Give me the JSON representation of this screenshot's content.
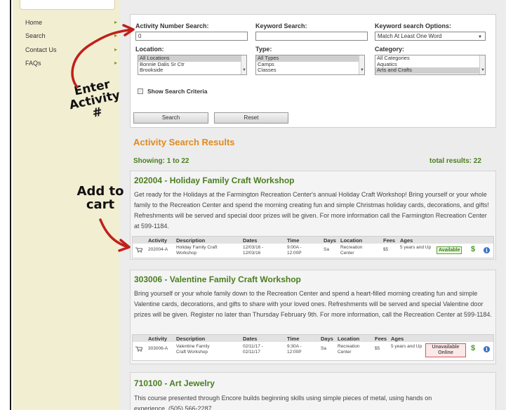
{
  "sidebar": {
    "items": [
      {
        "label": "Home"
      },
      {
        "label": "Search"
      },
      {
        "label": "Contact Us"
      },
      {
        "label": "FAQs"
      }
    ],
    "arrow": "▸"
  },
  "search": {
    "activity_number_label": "Activity Number Search:",
    "activity_number_value": "0",
    "keyword_label": "Keyword Search:",
    "keyword_value": "",
    "keyword_options_label": "Keyword search Options:",
    "keyword_options_value": "Match At Least One Word",
    "location_label": "Location:",
    "location_options": [
      "All Locations",
      "Bonnie Dalis Sr Ctr",
      "Brookside"
    ],
    "type_label": "Type:",
    "type_options": [
      "All Types",
      "Camps",
      "Classes"
    ],
    "category_label": "Category:",
    "category_options": [
      "All Categories",
      "Aquatics",
      "Arts and Crafts"
    ],
    "show_criteria_label": "Show Search Criteria",
    "search_button": "Search",
    "reset_button": "Reset"
  },
  "results": {
    "title": "Activity Search Results",
    "showing": "Showing: 1 to 22",
    "total": "total results: 22"
  },
  "table_headers": [
    "Activity",
    "Description",
    "Dates",
    "Time",
    "Days",
    "Location",
    "Fees",
    "Ages"
  ],
  "cards": [
    {
      "title": "202004 - Holiday Family Craft Workshop",
      "desc": "Get ready for the Holidays at the Farmington Recreation Center's annual Holiday Craft Workshop! Bring yourself or your whole family to the Recreation Center and spend the morning creating fun and simple Christmas holiday cards, decorations, and gifts! Refreshments will be served and special door prizes will be given. For more information call the Farmington Recreation Center at 599-1184.",
      "row": {
        "activity": "202004-A",
        "description": "Holiday Family Craft Workshop",
        "dates": "12/03/16 - 12/03/16",
        "time": "9:00A - 12:00P",
        "days": "Sa",
        "location": "Recreation Center",
        "fees": "$5",
        "ages": "5 years and Up",
        "status": "Available"
      }
    },
    {
      "title": "303006 - Valentine Family Craft Workshop",
      "desc": "Bring yourself or your whole family down to the Recreation Center and spend a heart-filled morning creating fun and simple Valentine cards, decorations, and gifts to share with your loved ones. Refreshments will be served and special Valentine door prizes will be given. Register no later than Thursday February 9th. For more information, call the Recreation Center at 599-1184.",
      "row": {
        "activity": "303006-A",
        "description": "Valentine Family Craft Workshop",
        "dates": "02/11/17 - 02/11/17",
        "time": "9:30A - 12:00P",
        "days": "Sa",
        "location": "Recreation Center",
        "fees": "$5",
        "ages": "5 years and Up",
        "status": "Unavailable Online"
      }
    },
    {
      "title": "710100 - Art Jewelry",
      "desc": "This course presented through Encore builds beginning skills using simple pieces of metal, using hands on experience. (505) 566-2287"
    }
  ],
  "annotations": {
    "enter_activity": "Enter Activity #",
    "add_to_cart": "Add to cart"
  },
  "icons": {
    "cart": "cart-icon",
    "dollar": "$",
    "info": "i"
  },
  "colors": {
    "accent_orange": "#e08a1e",
    "title_green": "#4a7e1f",
    "sidebar_bg": "#f2eed2",
    "info_blue": "#3b6fc4"
  }
}
